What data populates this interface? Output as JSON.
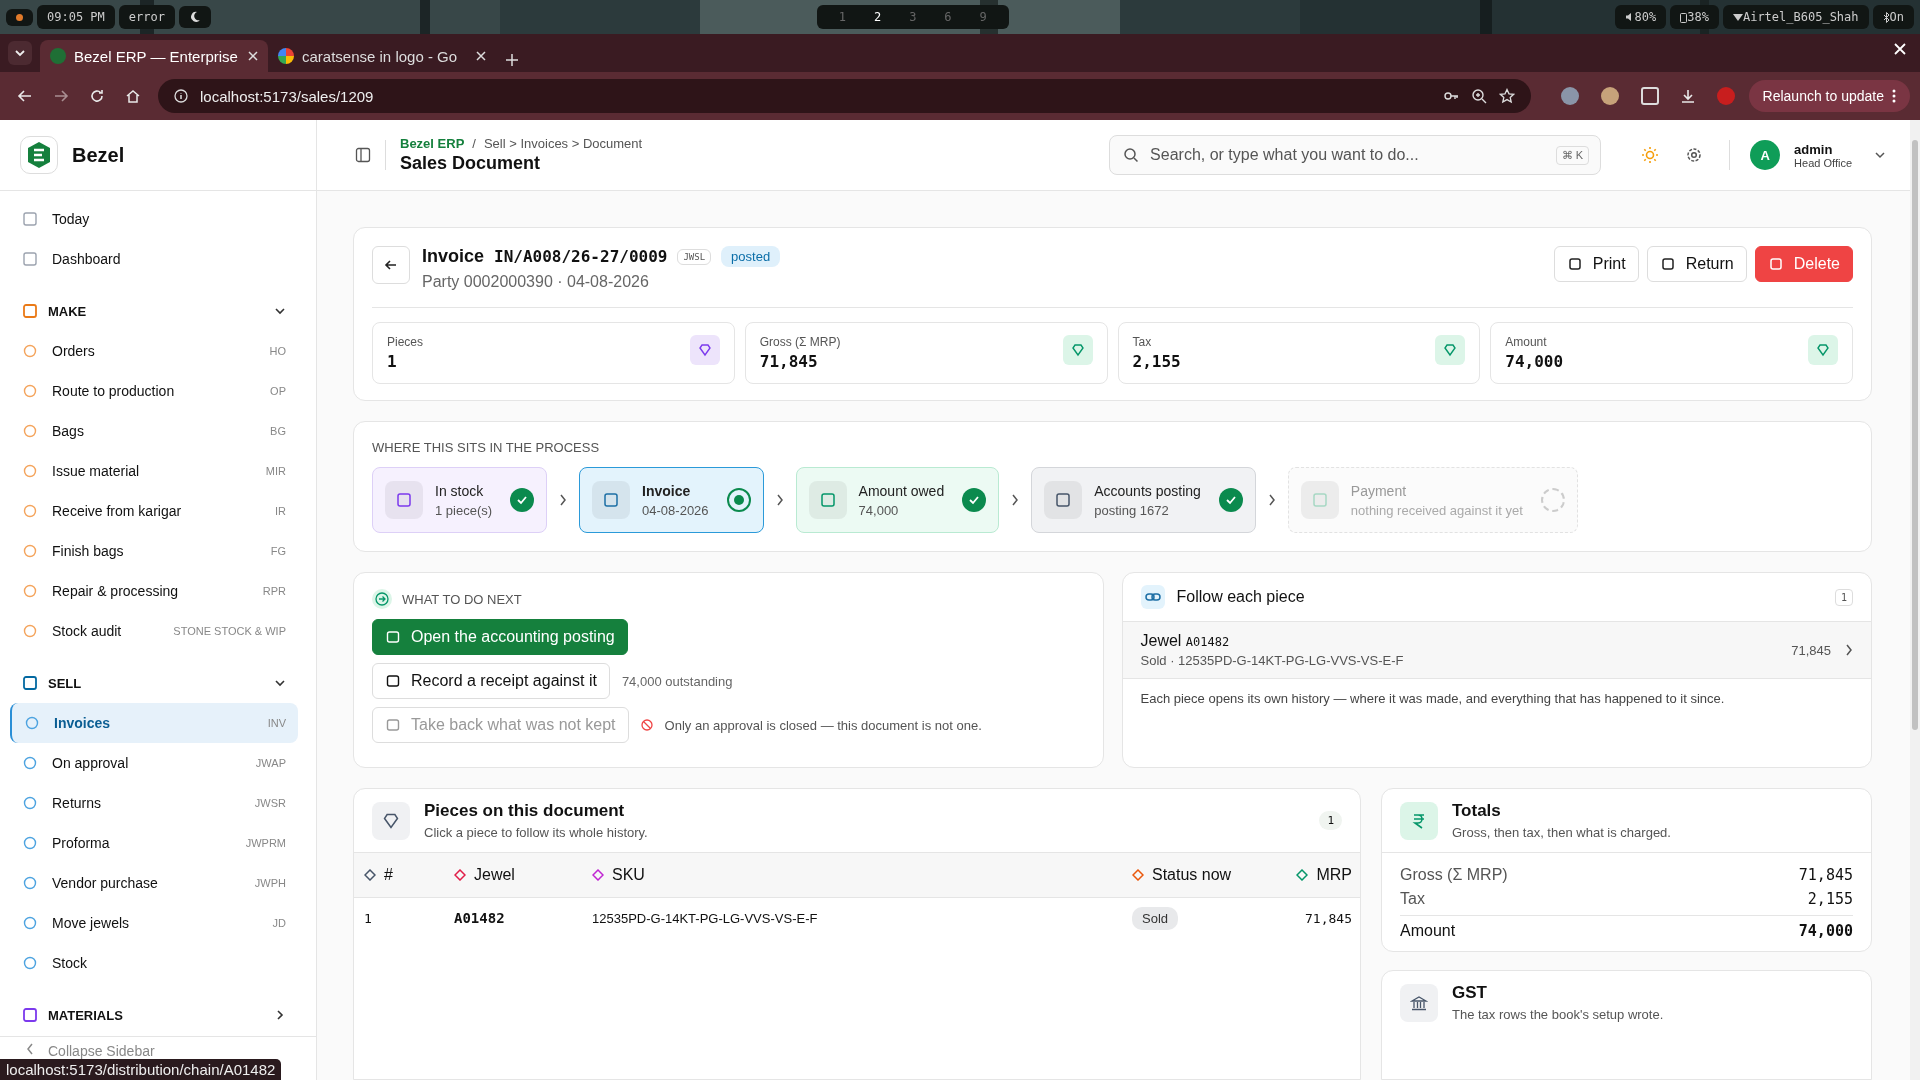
{
  "os_bar": {
    "time": "09:05 PM",
    "status": "error",
    "workspaces": [
      {
        "label": "1",
        "selected": false
      },
      {
        "label": "2",
        "selected": true
      },
      {
        "label": "3",
        "selected": false
      },
      {
        "label": "6",
        "selected": false
      },
      {
        "label": "9",
        "selected": false
      }
    ],
    "volume": "80%",
    "battery": "38%",
    "network": "Airtel_B605_Shah",
    "bluetooth": "On"
  },
  "browser": {
    "tabs": [
      {
        "title": "Bezel ERP — Enterprise",
        "selected": true
      },
      {
        "title": "caratsense in logo - Go",
        "selected": false
      }
    ],
    "url": "localhost:5173/sales/1209",
    "update_button": "Relaunch to update",
    "status_link": "localhost:5173/distribution/chain/A01482"
  },
  "sidebar": {
    "brand": "Bezel",
    "top_items": [
      {
        "label": "Today",
        "selected": false
      },
      {
        "label": "Dashboard",
        "selected": false
      }
    ],
    "sections": [
      {
        "title": "MAKE",
        "expanded": true,
        "items": [
          {
            "label": "Orders",
            "shortcut": "HO",
            "selected": false
          },
          {
            "label": "Route to production",
            "shortcut": "OP",
            "selected": false
          },
          {
            "label": "Bags",
            "shortcut": "BG",
            "selected": false
          },
          {
            "label": "Issue material",
            "shortcut": "MIR",
            "selected": false
          },
          {
            "label": "Receive from karigar",
            "shortcut": "IR",
            "selected": false
          },
          {
            "label": "Finish bags",
            "shortcut": "FG",
            "selected": false
          },
          {
            "label": "Repair & processing",
            "shortcut": "RPR",
            "selected": false
          },
          {
            "label": "Stock audit",
            "shortcut": "STONE STOCK & WIP",
            "selected": false
          }
        ]
      },
      {
        "title": "SELL",
        "expanded": true,
        "items": [
          {
            "label": "Invoices",
            "shortcut": "INV",
            "selected": true
          },
          {
            "label": "On approval",
            "shortcut": "JWAP",
            "selected": false
          },
          {
            "label": "Returns",
            "shortcut": "JWSR",
            "selected": false
          },
          {
            "label": "Proforma",
            "shortcut": "JWPRM",
            "selected": false
          },
          {
            "label": "Vendor purchase",
            "shortcut": "JWPH",
            "selected": false
          },
          {
            "label": "Move jewels",
            "shortcut": "JD",
            "selected": false
          },
          {
            "label": "Stock",
            "selected": false
          }
        ]
      },
      {
        "title": "MATERIALS",
        "expanded": false
      }
    ],
    "collapse": "Collapse Sidebar"
  },
  "header": {
    "breadcrumb_root": "Bezel ERP",
    "breadcrumb_separator": "/",
    "breadcrumb_path": "Sell > Invoices > Document",
    "title": "Sales Document",
    "search": {
      "placeholder": "Search, or type what you want to do...",
      "shortcut": "⌘ K"
    },
    "user": {
      "initial": "A",
      "name": "admin",
      "location": "Head Office"
    }
  },
  "document": {
    "type": "Invoice",
    "number": "IN/A008/26-27/0009",
    "code": "JWSL",
    "status": "posted",
    "subtitle": "Party 0002000390 · 04-08-2026",
    "actions": [
      {
        "label": "Print",
        "kind": "default"
      },
      {
        "label": "Return",
        "kind": "default"
      },
      {
        "label": "Delete",
        "kind": "danger"
      }
    ],
    "stats": [
      {
        "label": "Pieces",
        "value": "1"
      },
      {
        "label": "Gross (Σ MRP)",
        "value": "71,845"
      },
      {
        "label": "Tax",
        "value": "2,155"
      },
      {
        "label": "Amount",
        "value": "74,000"
      }
    ]
  },
  "process": {
    "title": "WHERE THIS SITS IN THE PROCESS",
    "steps": [
      {
        "title": "In stock",
        "detail": "1 piece(s)",
        "kind": "done"
      },
      {
        "title": "Invoice",
        "detail": "04-08-2026",
        "kind": "current"
      },
      {
        "title": "Amount owed",
        "detail": "74,000",
        "kind": "done"
      },
      {
        "title": "Accounts posting",
        "detail": "posting 1672",
        "kind": "done"
      },
      {
        "title": "Payment",
        "detail": "nothing received against it yet",
        "kind": "pending"
      }
    ]
  },
  "next": {
    "title": "WHAT TO DO NEXT",
    "actions": [
      {
        "label": "Open the accounting posting",
        "kind": "primary"
      },
      {
        "label": "Record a receipt against it",
        "kind": "default",
        "note": "74,000 outstanding"
      },
      {
        "label": "Take back what was not kept",
        "kind": "disabled",
        "note": "Only an approval is closed — this document is not one."
      }
    ]
  },
  "follow": {
    "title": "Follow each piece",
    "count": "1",
    "pieces": [
      {
        "prefix": "Jewel",
        "code": "A01482",
        "detail": "Sold · 12535PD-G-14KT-PG-LG-VVS-VS-E-F",
        "value": "71,845"
      }
    ],
    "note": "Each piece opens its own history — where it was made, and everything that has happened to it since."
  },
  "pieces": {
    "title": "Pieces on this document",
    "subtitle": "Click a piece to follow its whole history.",
    "count": "1",
    "columns": [
      "#",
      "Jewel",
      "SKU",
      "Status now",
      "MRP"
    ],
    "rows": [
      {
        "number": "1",
        "jewel": "A01482",
        "sku": "12535PD-G-14KT-PG-LG-VVS-VS-E-F",
        "status": "Sold",
        "mrp": "71,845"
      }
    ]
  },
  "totals": {
    "title": "Totals",
    "subtitle": "Gross, then tax, then what is charged.",
    "rows": [
      {
        "label": "Gross (Σ MRP)",
        "value": "71,845",
        "kind": "line"
      },
      {
        "label": "Tax",
        "value": "2,155",
        "kind": "line"
      },
      {
        "label": "Amount",
        "value": "74,000",
        "kind": "total"
      }
    ]
  },
  "gst": {
    "title": "GST",
    "subtitle": "The tax rows the book's setup wrote."
  }
}
